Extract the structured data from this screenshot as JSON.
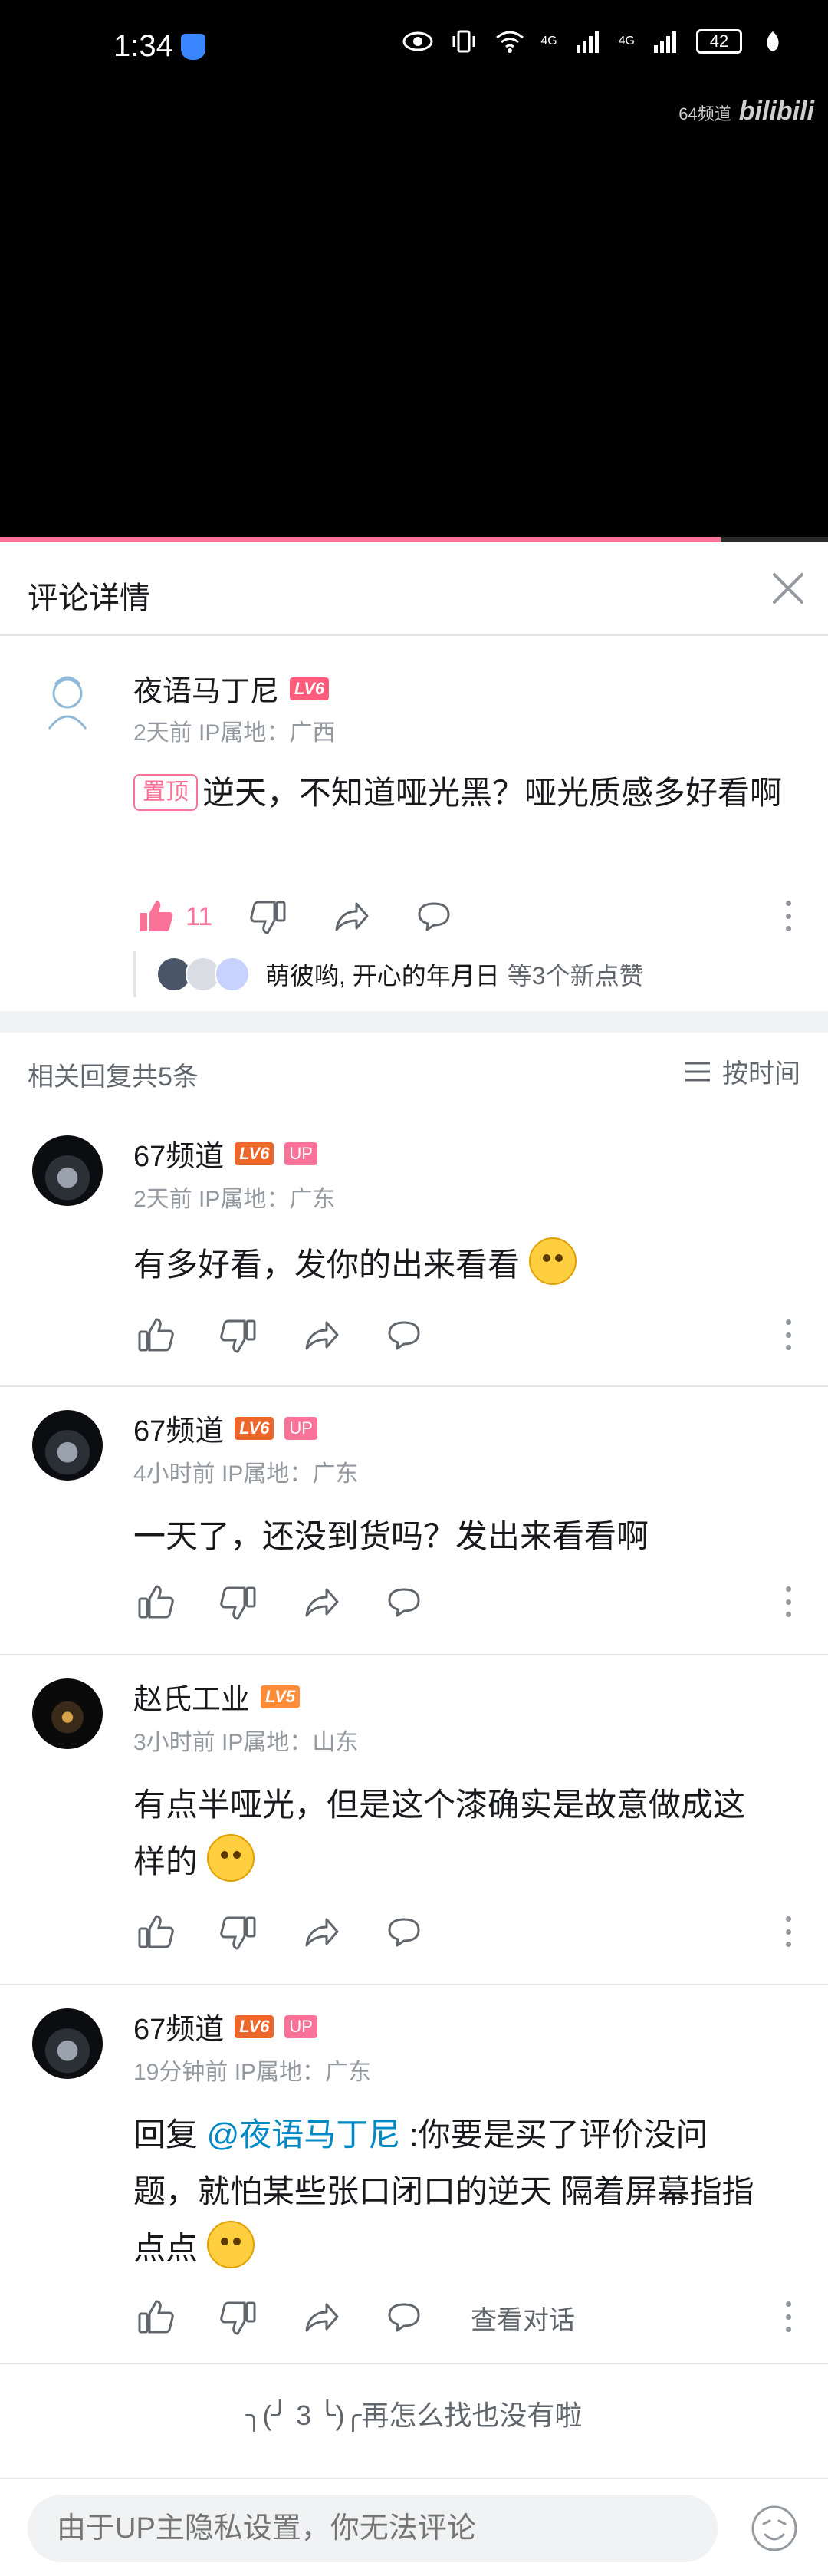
{
  "status_bar": {
    "time": "1:34",
    "battery": "42",
    "signal_a": "4G",
    "signal_b": "4G"
  },
  "video": {
    "watermark_channel": "64频道",
    "watermark_logo": "bilibili",
    "progress": 0.87
  },
  "panel": {
    "title": "评论详情"
  },
  "main_comment": {
    "username": "夜语马丁尼",
    "level": "LV6",
    "meta": "2天前 IP属地：广西",
    "pin_label": "置顶",
    "text": "逆天，不知道哑光黑？哑光质感多好看啊",
    "like_count": "11",
    "likers": "萌彼哟, 开心的年月日",
    "likers_tail": "等3个新点赞"
  },
  "replies_header": {
    "count_label": "相关回复共5条",
    "sort_label": "按时间"
  },
  "replies": [
    {
      "username": "67频道",
      "level": "LV6",
      "up": "UP",
      "meta": "2天前 IP属地：广东",
      "text": "有多好看，发你的出来看看"
    },
    {
      "username": "67频道",
      "level": "LV6",
      "up": "UP",
      "meta": "4小时前 IP属地：广东",
      "text": "一天了，还没到货吗？发出来看看啊"
    },
    {
      "username": "赵氏工业",
      "level": "LV5",
      "meta": "3小时前 IP属地：山东",
      "text_line1": "有点半哑光，但是这个漆确实是故意做成这",
      "text_line2": "样的"
    },
    {
      "username": "67频道",
      "level": "LV6",
      "up": "UP",
      "meta": "19分钟前 IP属地：广东",
      "reply_prefix": "回复 ",
      "mention": "@夜语马丁尼",
      "text_line1": " :你要是买了评价没问",
      "text_line2": "题，就怕某些张口闭口的逆天 隔着屏幕指指",
      "text_line3": "点点",
      "see_conversation": "查看对话"
    }
  ],
  "end_tip": "╮(╯ 3 ╰)╭再怎么找也没有啦",
  "input": {
    "placeholder": "由于UP主隐私设置，你无法评论"
  }
}
